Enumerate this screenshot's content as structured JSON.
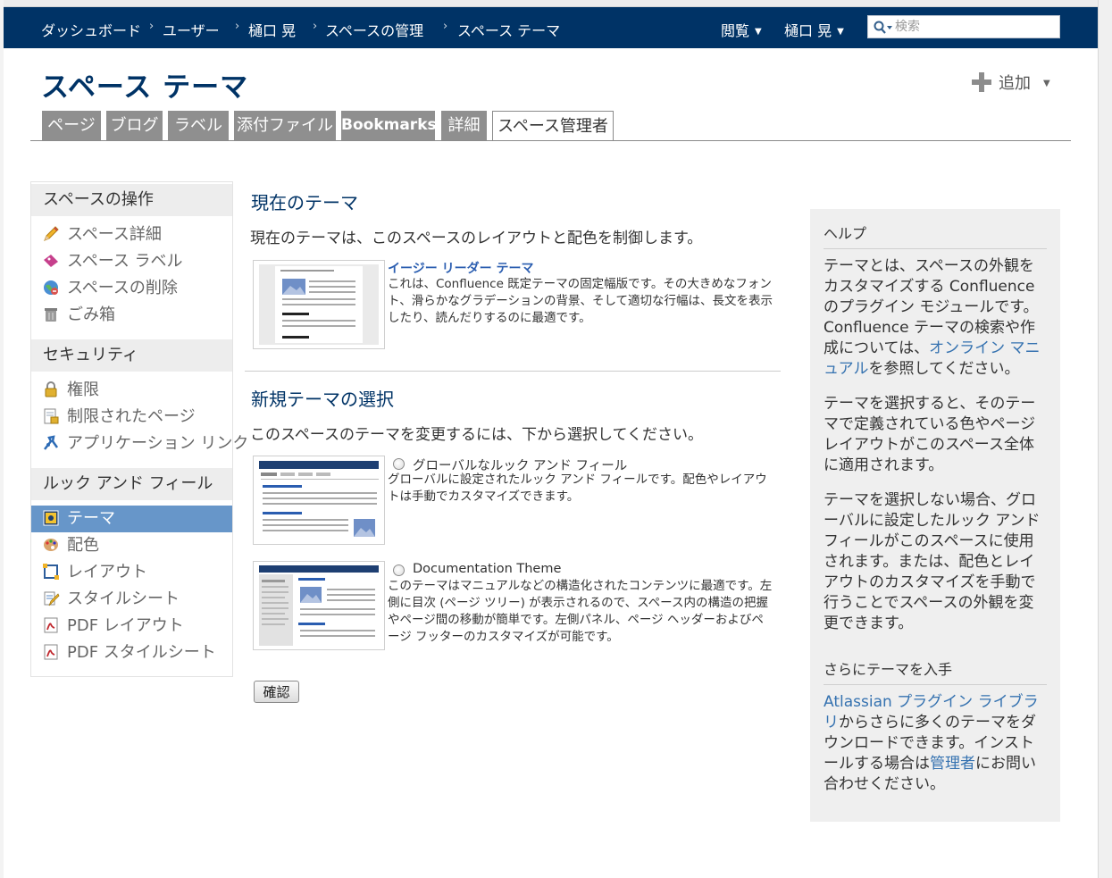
{
  "header": {
    "breadcrumbs": [
      "ダッシュボード",
      "ユーザー",
      "樋口 晃",
      "スペースの管理",
      "スペース テーマ"
    ],
    "browse_label": "閲覧",
    "user_label": "樋口 晃",
    "search_placeholder": "検索"
  },
  "page": {
    "title": "スペース テーマ",
    "add_label": "追加"
  },
  "tabs": [
    {
      "label": "ページ"
    },
    {
      "label": "ブログ"
    },
    {
      "label": "ラベル"
    },
    {
      "label": "添付ファイル"
    },
    {
      "label": "Bookmarks"
    },
    {
      "label": "詳細"
    },
    {
      "label": "スペース管理者"
    }
  ],
  "sidebar": {
    "sections": [
      {
        "heading": "スペースの操作",
        "items": [
          {
            "label": "スペース詳細",
            "icon": "pencil-icon"
          },
          {
            "label": "スペース ラベル",
            "icon": "label-icon"
          },
          {
            "label": "スペースの削除",
            "icon": "globe-delete-icon"
          },
          {
            "label": "ごみ箱",
            "icon": "trash-icon"
          }
        ]
      },
      {
        "heading": "セキュリティ",
        "items": [
          {
            "label": "権限",
            "icon": "lock-icon"
          },
          {
            "label": "制限されたページ",
            "icon": "restricted-page-icon"
          },
          {
            "label": "アプリケーション リンク",
            "icon": "app-link-icon"
          }
        ]
      },
      {
        "heading": "ルック アンド フィール",
        "items": [
          {
            "label": "テーマ",
            "icon": "theme-icon",
            "active": true
          },
          {
            "label": "配色",
            "icon": "palette-icon"
          },
          {
            "label": "レイアウト",
            "icon": "layout-icon"
          },
          {
            "label": "スタイルシート",
            "icon": "stylesheet-icon"
          },
          {
            "label": "PDF レイアウト",
            "icon": "pdf-icon"
          },
          {
            "label": "PDF スタイルシート",
            "icon": "pdf-icon"
          }
        ]
      }
    ]
  },
  "main": {
    "current_title": "現在のテーマ",
    "current_desc": "現在のテーマは、このスペースのレイアウトと配色を制御します。",
    "current_theme": {
      "name": "イージー リーダー テーマ",
      "description": "これは、Confluence 既定テーマの固定幅版です。その大きめなフォント、滑らかなグラデーションの背景、そして適切な行幅は、長文を表示したり、読んだりするのに最適です。"
    },
    "new_title": "新規テーマの選択",
    "new_desc": "このスペースのテーマを変更するには、下から選択してください。",
    "options": [
      {
        "name": "グローバルなルック アンド フィール",
        "description": "グローバルに設定されたルック アンド フィールです。配色やレイアウトは手動でカスタマイズできます。",
        "selected": false
      },
      {
        "name": "Documentation Theme",
        "description": "このテーマはマニュアルなどの構造化されたコンテンツに最適です。左側に目次 (ページ ツリー) が表示されるので、スペース内の構造の把握やページ間の移動が簡単です。左側パネル、ページ ヘッダーおよびページ フッターのカスタマイズが可能です。",
        "selected": false
      }
    ],
    "confirm_label": "確認"
  },
  "help": {
    "heading": "ヘルプ",
    "p1_before": "テーマとは、スペースの外観をカスタマイズする Confluence のプラグイン モジュールです。Confluence テーマの検索や作成については、",
    "p1_link": "オンライン マニュアル",
    "p1_after": "を参照してください。",
    "p2": "テーマを選択すると、そのテーマで定義されている色やページ レイアウトがこのスペース全体に適用されます。",
    "p3": "テーマを選択しない場合、グローバルに設定したルック アンド フィールがこのスペースに使用されます。または、配色とレイアウトのカスタマイズを手動で行うことでスペースの外観を変更できます。",
    "more_heading": "さらにテーマを入手",
    "p4_link1": "Atlassian プラグイン ライブラリ",
    "p4_mid": "からさらに多くのテーマをダウンロードできます。インストールする場合は",
    "p4_link2": "管理者",
    "p4_after": "にお問い合わせください。"
  },
  "colors": {
    "header_bg": "#003366",
    "title": "#003366",
    "tab_bg": "#8f8f8f",
    "sidebar_active": "#6796c9",
    "link": "#3572b0"
  }
}
